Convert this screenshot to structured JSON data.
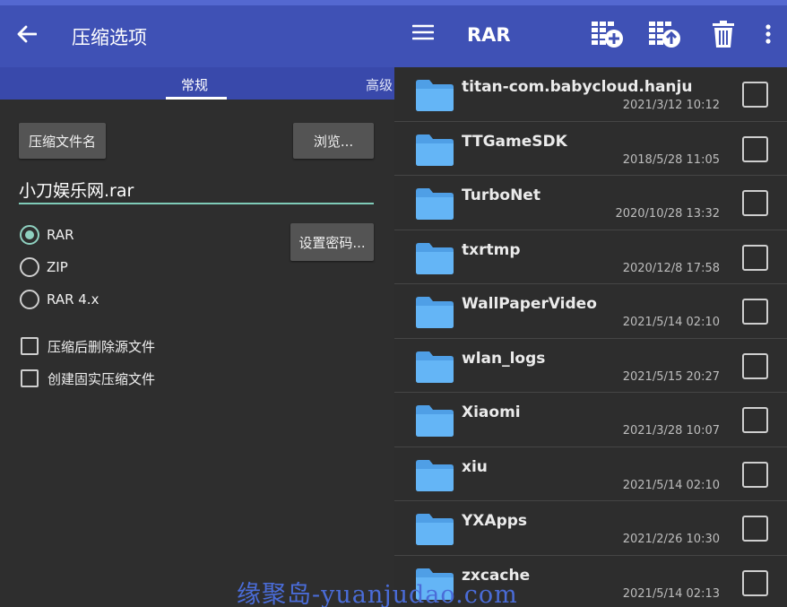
{
  "left": {
    "title": "压缩选项",
    "tabs": [
      "常规",
      "高级"
    ],
    "name_button": "压缩文件名",
    "browse_button": "浏览...",
    "filename": "小刀娱乐网.rar",
    "formats": [
      {
        "label": "RAR",
        "checked": true
      },
      {
        "label": "ZIP",
        "checked": false
      },
      {
        "label": "RAR 4.x",
        "checked": false
      }
    ],
    "password_button": "设置密码...",
    "options": [
      {
        "label": "压缩后删除源文件",
        "checked": false
      },
      {
        "label": "创建固实压缩文件",
        "checked": false
      }
    ]
  },
  "right": {
    "title": "RAR",
    "toolbar_icons": [
      "add-archive-icon",
      "extract-icon",
      "delete-icon",
      "more-vert-icon"
    ],
    "files": [
      {
        "name": "titan-com.babycloud.hanju",
        "date": "2021/3/12 10:12"
      },
      {
        "name": "TTGameSDK",
        "date": "2018/5/28 11:05"
      },
      {
        "name": "TurboNet",
        "date": "2020/10/28 13:32"
      },
      {
        "name": "txrtmp",
        "date": "2020/12/8 17:58"
      },
      {
        "name": "WallPaperVideo",
        "date": "2021/5/14 02:10"
      },
      {
        "name": "wlan_logs",
        "date": "2021/5/15 20:27"
      },
      {
        "name": "Xiaomi",
        "date": "2021/3/28 10:07"
      },
      {
        "name": "xiu",
        "date": "2021/5/14 02:10"
      },
      {
        "name": "YXApps",
        "date": "2021/2/26 10:30"
      },
      {
        "name": "zxcache",
        "date": "2021/5/14 02:13"
      }
    ]
  },
  "watermark": "缘聚岛-yuanjudao.com",
  "colors": {
    "appbar": "#3f51b5",
    "tabbar": "#3949ab",
    "accent": "#8fd1c0",
    "folder": "#64b5f6",
    "background": "#2d2d2d"
  }
}
